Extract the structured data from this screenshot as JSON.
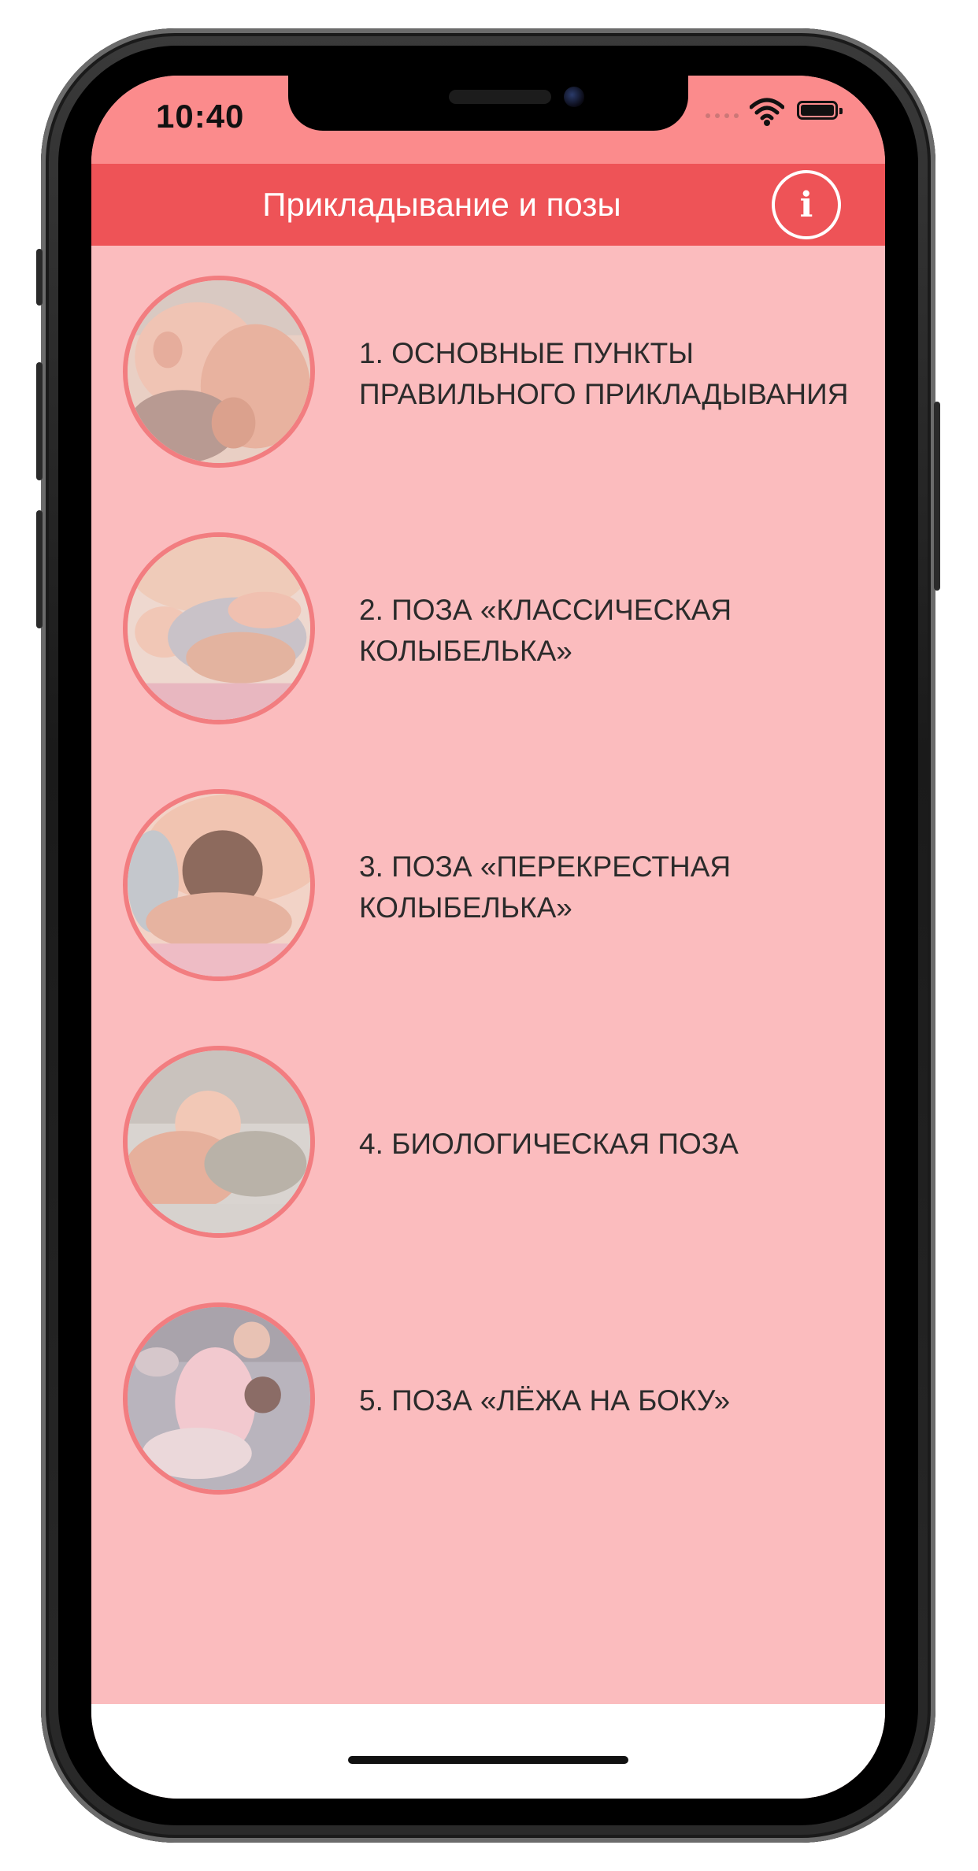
{
  "status_bar": {
    "time": "10:40"
  },
  "header": {
    "title": "Прикладывание и позы",
    "info_glyph": "i"
  },
  "items": [
    {
      "label": "1. ОСНОВНЫЕ ПУНКТЫ ПРАВИЛЬНОГО ПРИКЛАДЫВАНИЯ",
      "icon": "photo-breastfeeding-latch"
    },
    {
      "label": "2. ПОЗА «КЛАССИЧЕСКАЯ КОЛЫБЕЛЬКА»",
      "icon": "photo-cradle-hold"
    },
    {
      "label": "3. ПОЗА «ПЕРЕКРЕСТНАЯ КОЛЫБЕЛЬКА»",
      "icon": "photo-cross-cradle-hold"
    },
    {
      "label": "4. БИОЛОГИЧЕСКАЯ ПОЗА",
      "icon": "photo-biological-position"
    },
    {
      "label": "5. ПОЗА «ЛЁЖА НА БОКУ»",
      "icon": "photo-side-lying"
    }
  ],
  "colors": {
    "status_bar": "#fb8b8c",
    "navbar": "#ee5357",
    "background": "#fbbcbe",
    "thumb_border": "#f27d80",
    "text": "#2b2b2b"
  }
}
